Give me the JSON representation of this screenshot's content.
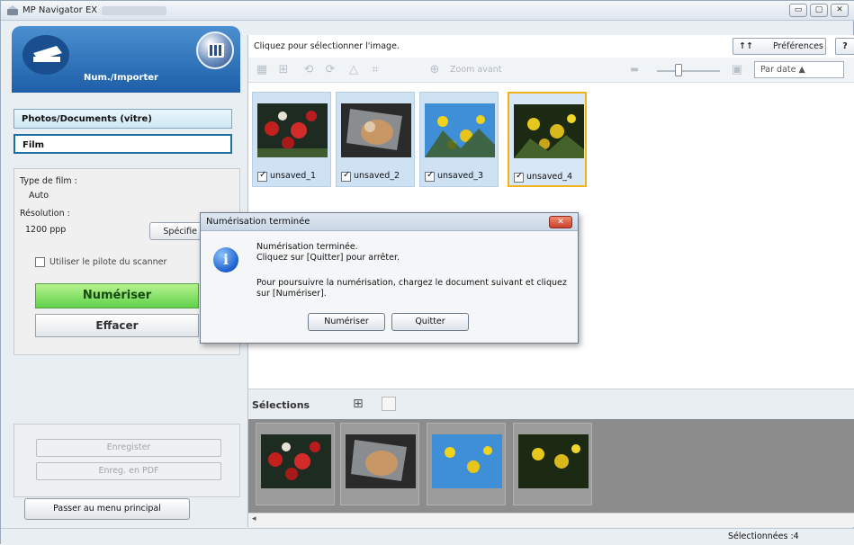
{
  "window": {
    "title": "MP Navigator EX"
  },
  "sidebar": {
    "mode_label": "Num./Importer",
    "sources": [
      "Photos/Documents (vitre)",
      "Film"
    ],
    "settings": {
      "film_type_label": "Type de film :",
      "film_type_value": "Auto",
      "resolution_label": "Résolution :",
      "resolution_value": "1200 ppp",
      "spec_button": "Spécifie",
      "driver_checkbox": "Utiliser le pilote du scanner"
    },
    "scan_button": "Numériser",
    "clear_button": "Effacer",
    "save_button": "Enregister",
    "save_pdf_button": "Enreg. en PDF",
    "main_menu_button": "Passer au menu principal"
  },
  "main": {
    "hint": "Cliquez pour sélectionner l'image.",
    "preferences_button": "Préférences",
    "help_button": "?",
    "zoom_label": "Zoom avant",
    "sort_label": "Par date ▲",
    "thumbnails": [
      {
        "label": "unsaved_1",
        "checked": true
      },
      {
        "label": "unsaved_2",
        "checked": true
      },
      {
        "label": "unsaved_3",
        "checked": true
      },
      {
        "label": "unsaved_4",
        "checked": true
      }
    ],
    "selections_title": "Sélections"
  },
  "status": {
    "selected": "Sélectionnées :4"
  },
  "dialog": {
    "title": "Numérisation terminée",
    "line1": "Numérisation terminée.",
    "line2": "Cliquez sur [Quitter] pour arrêter.",
    "line3": "Pour poursuivre la numérisation, chargez le document suivant et cliquez",
    "line4": "sur [Numériser].",
    "scan_button": "Numériser",
    "quit_button": "Quitter"
  }
}
